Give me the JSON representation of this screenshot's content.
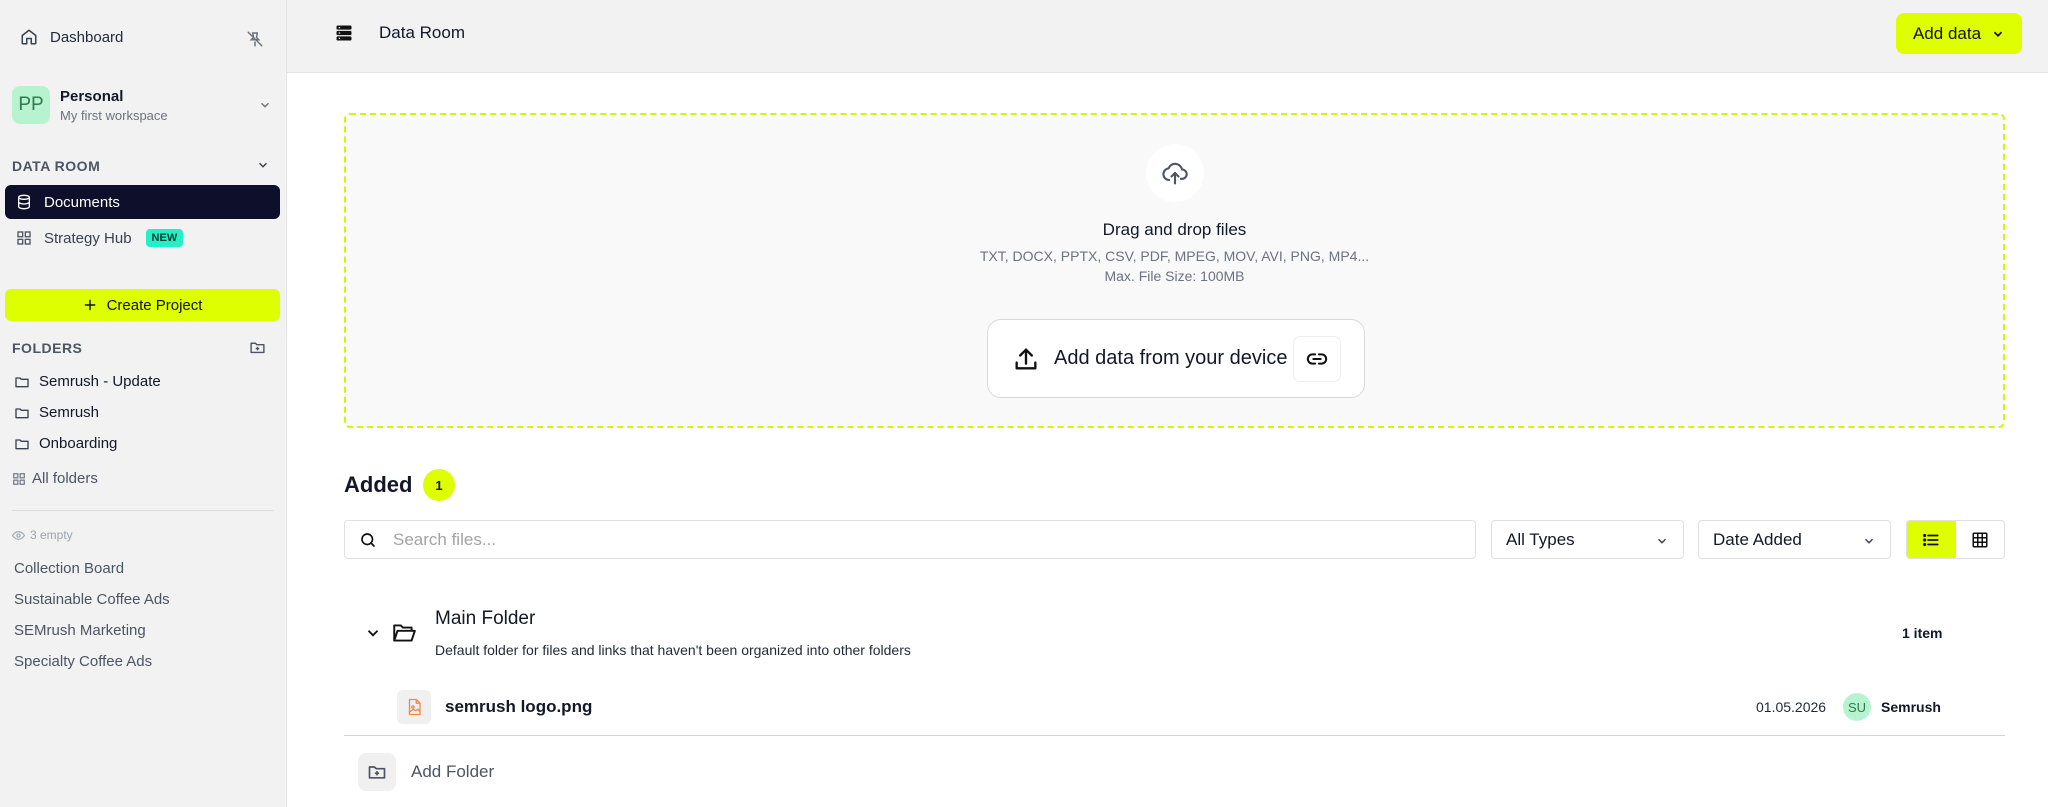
{
  "sidebar": {
    "dashboard_label": "Dashboard",
    "workspace": {
      "initials": "PP",
      "name": "Personal",
      "subtitle": "My first workspace"
    },
    "data_room_title": "DATA ROOM",
    "nav": [
      {
        "label": "Documents",
        "icon": "database-icon",
        "active": true
      },
      {
        "label": "Strategy Hub",
        "icon": "grid-icon",
        "badge": "NEW"
      }
    ],
    "create_project_label": "Create Project",
    "folders_title": "FOLDERS",
    "folders": [
      "Semrush - Update",
      "Semrush",
      "Onboarding"
    ],
    "all_folders_label": "All folders",
    "empty_label": "3 empty",
    "empty_items": [
      "Collection Board",
      "Sustainable Coffee Ads",
      "SEMrush Marketing",
      "Specialty Coffee Ads"
    ]
  },
  "header": {
    "title": "Data Room",
    "add_data_label": "Add data"
  },
  "dropzone": {
    "title": "Drag and drop files",
    "types": "TXT, DOCX, PPTX, CSV, PDF, MPEG, MOV, AVI, PNG, MP4...",
    "max_size": "Max. File Size: 100MB",
    "device_button_label": "Add data from your device"
  },
  "added": {
    "title": "Added",
    "count": "1",
    "search_placeholder": "Search files...",
    "type_filter": "All Types",
    "sort": "Date Added",
    "view_mode": "list"
  },
  "folder": {
    "name": "Main Folder",
    "description": "Default folder for files and links that haven't been organized into other folders",
    "item_count": "1 item",
    "files": [
      {
        "name": "semrush logo.png",
        "date": "01.05.2026",
        "owner_initials": "SU",
        "owner": "Semrush"
      }
    ]
  },
  "add_folder_label": "Add Folder",
  "colors": {
    "accent": "#ddff00",
    "nav_active_bg": "#0d0f2b",
    "badge_new": "#23f0c7",
    "avatar_bg": "#b8f3cf"
  }
}
